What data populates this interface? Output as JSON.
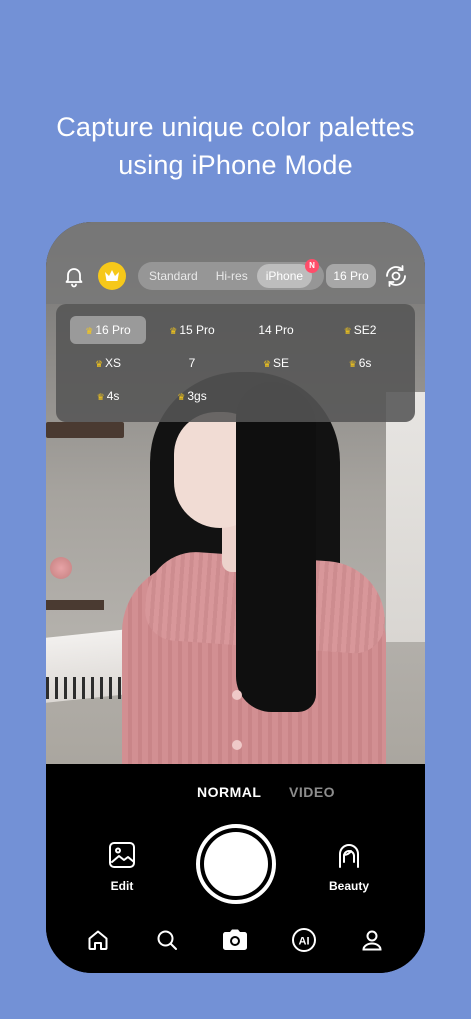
{
  "headline": {
    "line1": "Capture unique color palettes",
    "line2": "using iPhone Mode"
  },
  "topbar": {
    "icons": [
      "bell-icon",
      "crown-icon",
      "flip-camera-icon"
    ],
    "modes": [
      {
        "label": "Standard",
        "active": false
      },
      {
        "label": "Hi-res",
        "active": false
      },
      {
        "label": "iPhone",
        "active": true
      }
    ],
    "new_badge": "N",
    "model_pill": "16 Pro"
  },
  "dropdown": {
    "options": [
      {
        "label": "16 Pro",
        "premium": true,
        "selected": true
      },
      {
        "label": "15 Pro",
        "premium": true,
        "selected": false
      },
      {
        "label": "14 Pro",
        "premium": false,
        "selected": false
      },
      {
        "label": "SE2",
        "premium": true,
        "selected": false
      },
      {
        "label": "XS",
        "premium": true,
        "selected": false
      },
      {
        "label": "7",
        "premium": false,
        "selected": false
      },
      {
        "label": "SE",
        "premium": true,
        "selected": false
      },
      {
        "label": "6s",
        "premium": true,
        "selected": false
      },
      {
        "label": "4s",
        "premium": true,
        "selected": false
      },
      {
        "label": "3gs",
        "premium": true,
        "selected": false
      }
    ]
  },
  "capture_modes": {
    "normal": "NORMAL",
    "video": "VIDEO",
    "active": "NORMAL"
  },
  "controls": {
    "edit_label": "Edit",
    "beauty_label": "Beauty"
  },
  "tabbar": {
    "items": [
      "home-icon",
      "search-icon",
      "camera-icon",
      "ai-icon",
      "profile-icon"
    ],
    "ai_text": "AI",
    "active": "camera-icon"
  },
  "colors": {
    "background": "#7391d6",
    "premium_gold": "#f6c81a",
    "badge_red": "#ff4d6a"
  }
}
